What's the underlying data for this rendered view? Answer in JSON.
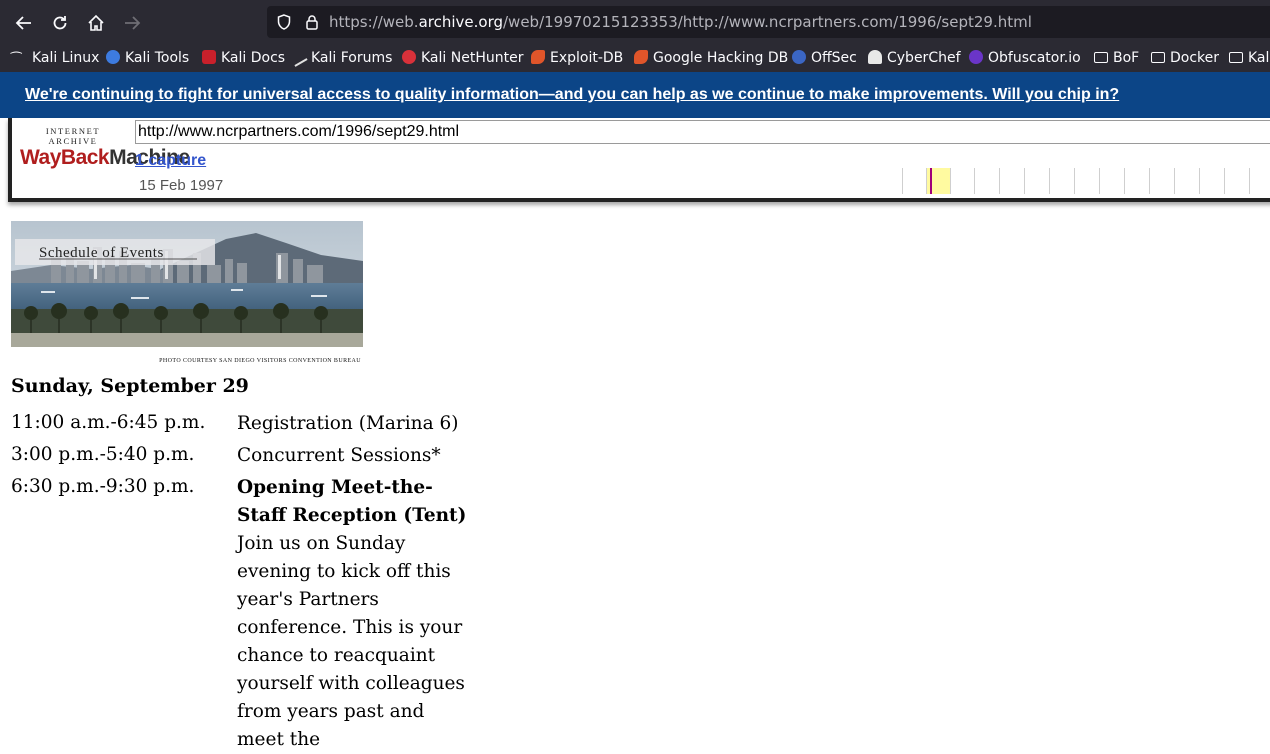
{
  "browser": {
    "url_prefix": "https://web.",
    "url_host": "archive.org",
    "url_rest": "/web/19970215123353/http://www.ncrpartners.com/1996/sept29.html",
    "bookmarks": [
      {
        "label": "Kali Linux",
        "icon": "kali-dragon-icon"
      },
      {
        "label": "Kali Tools",
        "icon": "kali-tools-icon"
      },
      {
        "label": "Kali Docs",
        "icon": "kali-docs-icon"
      },
      {
        "label": "Kali Forums",
        "icon": "kali-forums-icon"
      },
      {
        "label": "Kali NetHunter",
        "icon": "nethunter-icon"
      },
      {
        "label": "Exploit-DB",
        "icon": "exploit-db-icon"
      },
      {
        "label": "Google Hacking DB",
        "icon": "ghdb-icon"
      },
      {
        "label": "OffSec",
        "icon": "offsec-icon"
      },
      {
        "label": "CyberChef",
        "icon": "cyberchef-icon"
      },
      {
        "label": "Obfuscator.io",
        "icon": "js-icon"
      },
      {
        "label": "BoF",
        "icon": "folder-icon"
      },
      {
        "label": "Docker",
        "icon": "folder-icon"
      },
      {
        "label": "Kal",
        "icon": "folder-icon"
      }
    ]
  },
  "banner": {
    "text": "We're continuing to fight for universal access to quality information—and you can help as we continue to make improvements. Will you chip in?"
  },
  "wayback": {
    "logo_top": "INTERNET ARCHIVE",
    "logo_main_a": "WayBack",
    "logo_main_b": "Machine",
    "url_value": "http://www.ncrpartners.com/1996/sept29.html",
    "captures_link": "1 capture",
    "capture_date": "15 Feb 1997"
  },
  "page": {
    "hero_title": "Schedule of Events",
    "photo_credit": "PHOTO COURTESY SAN DIEGO VISITORS CONVENTION BUREAU",
    "day_heading": "Sunday, September 29",
    "events": [
      {
        "time": "11:00 a.m.-6:45 p.m.",
        "title": "",
        "desc": "Registration (Marina 6)"
      },
      {
        "time": "3:00 p.m.-5:40 p.m.",
        "title": "",
        "desc": "Concurrent Sessions*"
      },
      {
        "time": "6:30 p.m.-9:30 p.m.",
        "title": "Opening Meet-the-Staff Reception (Tent)",
        "desc": "Join us on Sunday evening to kick off this year's Partners conference. This is your chance to reacquaint yourself with colleagues from years past and meet the"
      }
    ]
  },
  "colors": {
    "chrome_bg": "#2b2a33",
    "urlbar_bg": "#1c1b22",
    "banner_bg": "#0c4587",
    "wayback_red": "#b01e1e",
    "link_blue": "#3355cc"
  }
}
